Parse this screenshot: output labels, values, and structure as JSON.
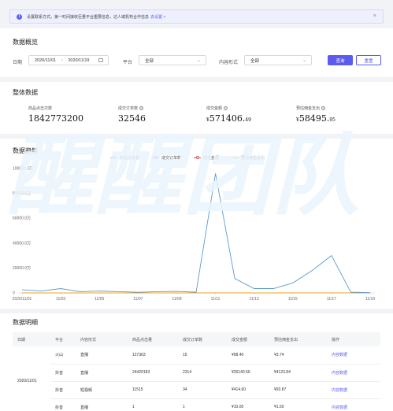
{
  "notice": {
    "text": "设置联系方式，第一时间接收巨量平台重要信息，达人或机构合作信息",
    "link": "去设置 >",
    "close": "×",
    "info_icon": "info-icon"
  },
  "overview": {
    "title": "数据概览",
    "date_label": "日期",
    "date_start": "2020/11/01",
    "date_sep": "~",
    "date_end": "2020/11/19",
    "platform_label": "平台",
    "platform_value": "全部",
    "content_label": "内容形式",
    "content_value": "全部",
    "query_button": "查询",
    "reset_button": "重置"
  },
  "totals": {
    "title": "整体数据",
    "items": [
      {
        "label": "商品点击次数",
        "value": "1842773200",
        "help": false
      },
      {
        "label": "成交订单数",
        "value": "32546",
        "help": true
      },
      {
        "label": "成交金额",
        "prefix": "¥",
        "main": "571406.",
        "decimals": "49",
        "help": true
      },
      {
        "label": "预估佣金支出",
        "prefix": "¥",
        "main": "58495.",
        "decimals": "95",
        "help": true
      }
    ],
    "help_icon": "?"
  },
  "trend": {
    "title": "数据趋势",
    "watermark": "醒醒团队"
  },
  "chart_data": {
    "type": "line",
    "x": [
      "2020/11/01",
      "11/02",
      "11/03",
      "11/04",
      "11/05",
      "11/06",
      "11/07",
      "11/08",
      "11/09",
      "11/10",
      "11/11",
      "11/12",
      "11/13",
      "11/14",
      "11/15",
      "11/16",
      "11/17",
      "11/18",
      "11/19"
    ],
    "tick_labels": [
      "2020/11/01",
      "11/03",
      "11/05",
      "11/07",
      "11/09",
      "11/11",
      "11/13",
      "11/15",
      "11/17",
      "11/19"
    ],
    "y_ticks": [
      "100000.0万",
      "80000.0万",
      "60000.0万",
      "40000.0万",
      "20000.0万",
      "0"
    ],
    "ylim": [
      0,
      100000
    ],
    "series": [
      {
        "name": "商品点击量",
        "color": "#5b9bd5",
        "values": [
          2500,
          1500,
          3500,
          1000,
          1500,
          1000,
          500,
          1000,
          1200,
          600,
          96000,
          11500,
          3500,
          3500,
          8000,
          18000,
          30000,
          600,
          200
        ]
      },
      {
        "name": "成交订单数",
        "color": "#5b5bf0",
        "values": [
          0,
          0,
          0,
          0,
          0,
          0,
          0,
          0,
          0,
          0,
          0,
          0,
          0,
          0,
          0,
          0,
          0,
          0,
          0
        ]
      },
      {
        "name": "成交金额",
        "color": "#e05050",
        "values": [
          0,
          0,
          0,
          0,
          0,
          0,
          0,
          0,
          0,
          0,
          0,
          0,
          0,
          0,
          0,
          0,
          0,
          0,
          0
        ]
      },
      {
        "name": "预估佣金支出",
        "color": "#f0a020",
        "values": [
          0,
          0,
          0,
          0,
          0,
          0,
          0,
          0,
          0,
          0,
          0,
          0,
          0,
          0,
          0,
          0,
          0,
          0,
          0
        ]
      }
    ]
  },
  "detail": {
    "title": "数据明细",
    "headers": [
      "日期",
      "平台",
      "内容形式",
      "商品点击量",
      "成交订单数",
      "成交金额",
      "预估佣金支出",
      "操作"
    ],
    "date": "2020/11/01",
    "rows": [
      [
        "火山",
        "直播",
        "127363",
        "15",
        "¥98.40",
        "¥3.74",
        "内容数据"
      ],
      [
        "抖音",
        "直播",
        "24420183",
        "2314",
        "¥26140.56",
        "¥4123.84",
        "内容数据"
      ],
      [
        "抖音",
        "短视频",
        "11515",
        "34",
        "¥414.60",
        "¥93.87",
        "内容数据"
      ],
      [
        "抖音",
        "直播",
        "1",
        "1",
        "¥10.00",
        "¥1.50",
        "内容数据"
      ]
    ]
  }
}
